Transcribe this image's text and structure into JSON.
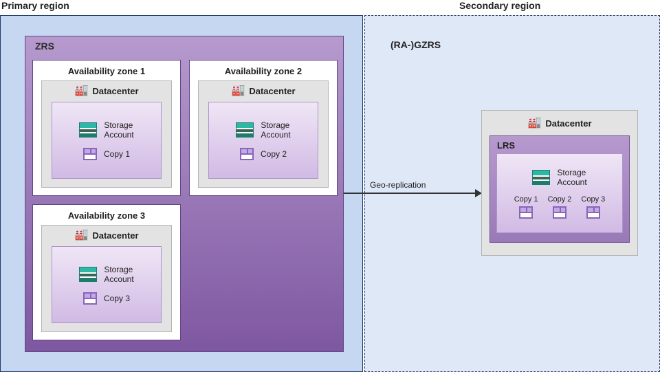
{
  "labels": {
    "primary": "Primary region",
    "secondary": "Secondary region",
    "ra_gzrs": "(RA-)GZRS",
    "geo_replication": "Geo-replication"
  },
  "zrs": {
    "title": "ZRS",
    "zones": [
      {
        "title": "Availability zone 1",
        "datacenter": "Datacenter",
        "storage_label": "Storage\nAccount",
        "copy_label": "Copy 1"
      },
      {
        "title": "Availability zone 2",
        "datacenter": "Datacenter",
        "storage_label": "Storage\nAccount",
        "copy_label": "Copy 2"
      },
      {
        "title": "Availability zone 3",
        "datacenter": "Datacenter",
        "storage_label": "Storage\nAccount",
        "copy_label": "Copy 3"
      }
    ]
  },
  "secondary_dc": {
    "datacenter": "Datacenter",
    "lrs_title": "LRS",
    "storage_label": "Storage\nAccount",
    "copies": [
      "Copy 1",
      "Copy 2",
      "Copy 3"
    ]
  }
}
